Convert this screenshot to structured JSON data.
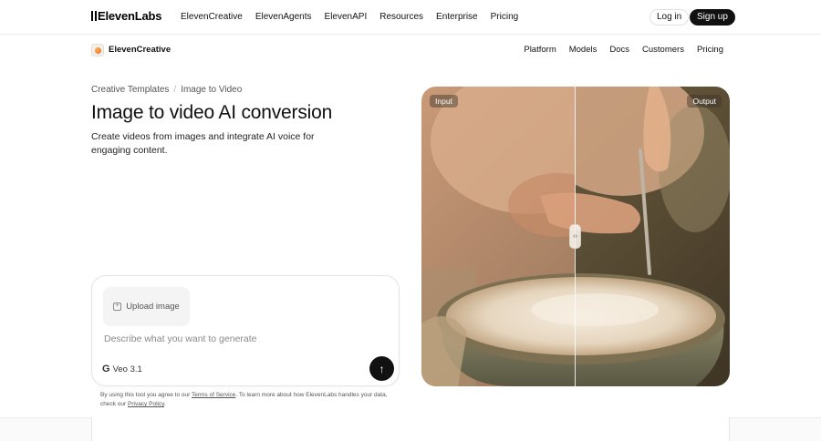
{
  "topnav": {
    "logo": "ElevenLabs",
    "links": [
      "ElevenCreative",
      "ElevenAgents",
      "ElevenAPI",
      "Resources",
      "Enterprise",
      "Pricing"
    ],
    "login_label": "Log in",
    "signup_label": "Sign up"
  },
  "subnav": {
    "product_name": "ElevenCreative",
    "links": [
      "Platform",
      "Models",
      "Docs",
      "Customers",
      "Pricing"
    ]
  },
  "hero": {
    "breadcrumb": [
      "Creative Templates",
      "Image to Video"
    ],
    "title": "Image to video AI conversion",
    "subtitle": "Create videos from images and integrate AI voice for engaging content."
  },
  "prompt_card": {
    "upload_label": "Upload image",
    "prompt_placeholder": "Describe what you want to generate",
    "model_label": "Veo 3.1"
  },
  "disclaimer": {
    "text_before": "By using this tool you agree to our ",
    "terms_link": "Terms of Service",
    "text_middle": ". To learn more about how ElevenLabs handles your data, check our ",
    "privacy_link": "Privacy Policy",
    "text_after": "."
  },
  "compare": {
    "input_label": "Input",
    "output_label": "Output"
  },
  "colors": {
    "accent_dark": "#111111",
    "card_border": "#e4e4e4"
  }
}
